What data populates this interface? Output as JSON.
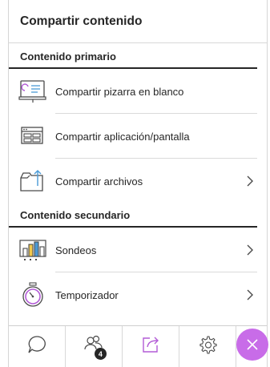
{
  "panel": {
    "title": "Compartir contenido"
  },
  "primary": {
    "title": "Contenido primario",
    "items": [
      {
        "label": "Compartir pizarra en blanco",
        "icon": "whiteboard-icon"
      },
      {
        "label": "Compartir aplicación/pantalla",
        "icon": "screen-share-icon"
      },
      {
        "label": "Compartir archivos",
        "icon": "folder-upload-icon"
      }
    ]
  },
  "secondary": {
    "title": "Contenido secundario",
    "items": [
      {
        "label": "Sondeos",
        "icon": "poll-chart-icon"
      },
      {
        "label": "Temporizador",
        "icon": "stopwatch-icon"
      }
    ]
  },
  "tabbar": {
    "tabs": [
      "chat-icon",
      "attendees-icon",
      "share-content-icon",
      "settings-icon"
    ],
    "attendees_badge": "4"
  },
  "colors": {
    "accent": "#c86ce8",
    "active_tab": "#b25bd6",
    "text": "#262626"
  }
}
